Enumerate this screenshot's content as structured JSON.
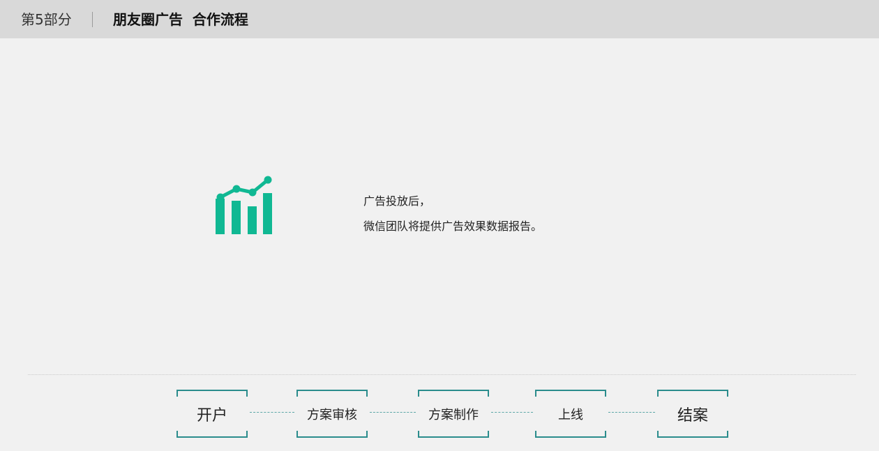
{
  "header": {
    "section": "第5部分",
    "title": "朋友圈广告  合作流程"
  },
  "info": {
    "line1": "广告投放后，",
    "line2": "微信团队将提供广告效果数据报告。"
  },
  "icon": {
    "name": "bar-chart-trend-icon",
    "color": "#10b893"
  },
  "flow": {
    "accent": "#2a8c8c",
    "steps": [
      "开户",
      "方案审核",
      "方案制作",
      "上线",
      "结案"
    ]
  }
}
